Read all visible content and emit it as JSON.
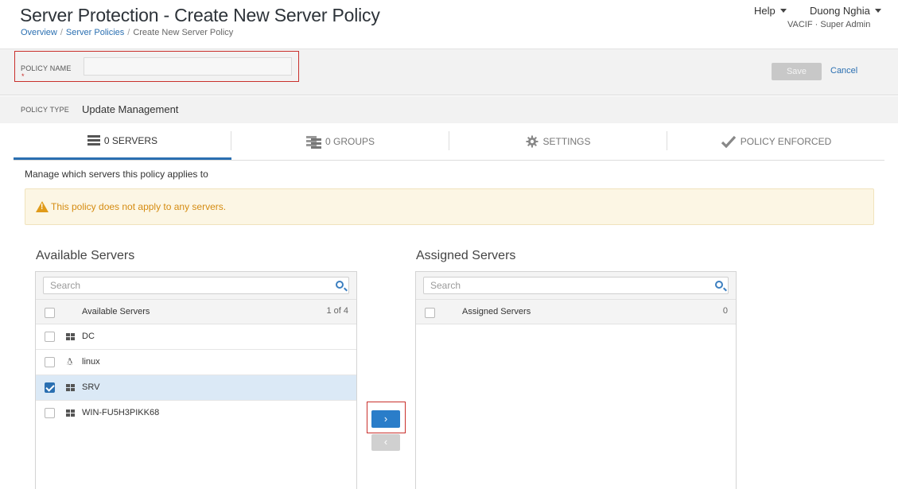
{
  "header": {
    "title": "Server Protection - Create New Server Policy",
    "breadcrumbs": [
      "Overview",
      "Server Policies",
      "Create New Server Policy"
    ],
    "help_label": "Help",
    "user_name": "Duong Nghia",
    "user_role": "VACIF · Super Admin"
  },
  "policy": {
    "name_label": "POLICY NAME",
    "name_required": "*",
    "name_value": "",
    "save_label": "Save",
    "cancel_label": "Cancel",
    "type_label": "POLICY TYPE",
    "type_value": "Update Management"
  },
  "tabs": [
    {
      "label": "0 SERVERS",
      "icon": "server-icon",
      "active": true
    },
    {
      "label": "0 GROUPS",
      "icon": "group-icon",
      "active": false
    },
    {
      "label": "SETTINGS",
      "icon": "gear-icon",
      "active": false
    },
    {
      "label": "POLICY ENFORCED",
      "icon": "checkmark-icon",
      "active": false
    }
  ],
  "main": {
    "description": "Manage which servers this policy applies to",
    "warning": "This policy does not apply to any servers."
  },
  "available": {
    "title": "Available Servers",
    "search_placeholder": "Search",
    "header_label": "Available Servers",
    "count": "1 of 4",
    "items": [
      {
        "name": "DC",
        "os": "windows",
        "checked": false
      },
      {
        "name": "linux",
        "os": "linux",
        "checked": false
      },
      {
        "name": "SRV",
        "os": "windows",
        "checked": true
      },
      {
        "name": "WIN-FU5H3PIKK68",
        "os": "windows",
        "checked": false
      }
    ]
  },
  "assigned": {
    "title": "Assigned Servers",
    "search_placeholder": "Search",
    "header_label": "Assigned Servers",
    "count": "0",
    "items": []
  },
  "transfer": {
    "add_symbol": "›",
    "remove_symbol": "‹"
  },
  "colors": {
    "accent": "#2a6fb1",
    "warning_text": "#d58c12",
    "warning_bg": "#fcf6e4",
    "highlight": "#c9302c"
  }
}
